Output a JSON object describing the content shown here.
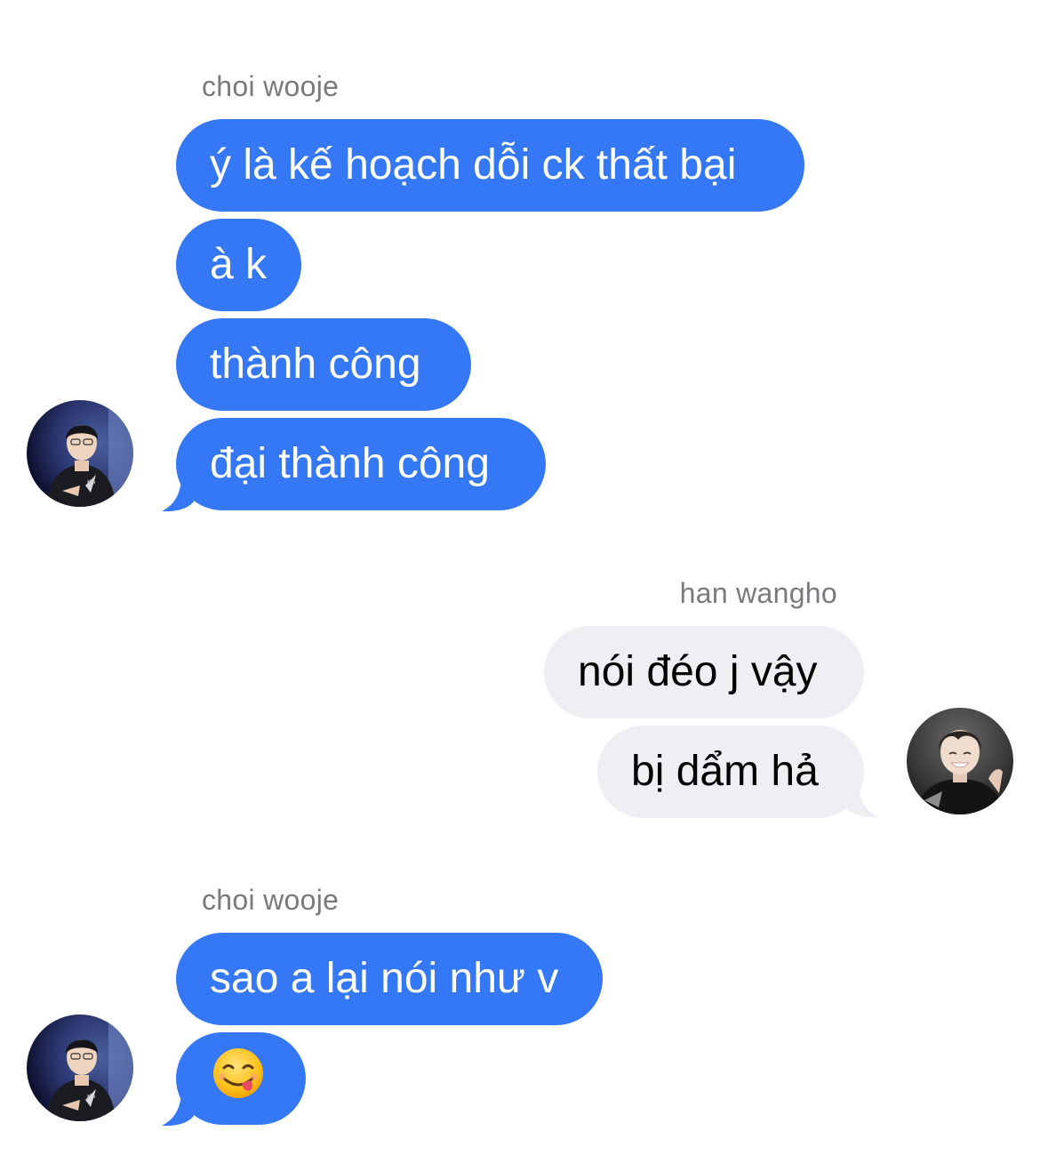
{
  "conversation": {
    "group1": {
      "sender": "choi wooje",
      "messages": [
        "ý là kế hoạch dỗi ck thất bại",
        "à k",
        "thành công",
        "đại thành công"
      ]
    },
    "group2": {
      "sender": "han wangho",
      "messages": [
        "nói đéo j vậy",
        "bị dẩm hả"
      ]
    },
    "group3": {
      "sender": "choi wooje",
      "messages": [
        "sao a lại nói như v"
      ],
      "emoji": "face-savoring-food-emoji"
    }
  },
  "colors": {
    "outgoing_bubble": "#3478f6",
    "incoming_bubble": "#eeeef3",
    "sender_name": "#7a7a7e"
  },
  "icons": {
    "avatar_wooje": "avatar-choi-wooje",
    "avatar_wangho": "avatar-han-wangho"
  }
}
